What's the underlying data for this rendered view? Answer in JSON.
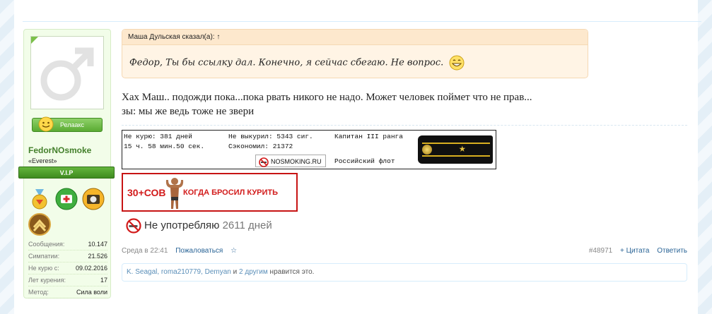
{
  "user": {
    "name": "FedorNOsmoke",
    "title": "«Everest»",
    "rank": "V.I.P",
    "status_button": "Релаакс",
    "stats": [
      {
        "label": "Сообщения:",
        "value": "10.147"
      },
      {
        "label": "Симпатии:",
        "value": "21.526"
      },
      {
        "label": "Не курю с:",
        "value": "09.02.2016"
      },
      {
        "label": "Лет курения:",
        "value": "17"
      },
      {
        "label": "Метод:",
        "value": "Сила воли"
      }
    ]
  },
  "quote": {
    "author": "Маша Дульская сказал(а): ↑",
    "text": "Федор, Ты бы ссылку дал. Конечно, я сейчас сбегаю. Не вопрос."
  },
  "message": {
    "line1": "Хах Маш.. подожди пока...пока рвать никого не надо. Может человек поймет что не прав...",
    "line2": "зы: мы же ведь тоже не звери"
  },
  "signature": {
    "banner": {
      "not_smoking": "Не курю: 381 дней",
      "time": "15 ч. 58 мин.50 сек.",
      "not_smoked": "Не выкурил: 5343 сиг.",
      "saved": "Сэкономил: 21372",
      "rank": "Капитан III ранга",
      "fleet": "Российский флот",
      "logo": "NOSMOKING.RU"
    },
    "red_banner": {
      "left": "30+СОВ",
      "right": "КОГДА БРОСИЛ КУРИТЬ"
    },
    "not_using_text": "Не употребляю",
    "not_using_days": "2611 дней"
  },
  "meta": {
    "date": "Среда в 22:41",
    "report": "Пожаловаться",
    "bookmark": "☆",
    "post_number": "#48971",
    "quote_action": "+ Цитата",
    "reply_action": "Ответить"
  },
  "likes": {
    "users": "K. Seagal, roma210779, Demyan",
    "and": " и ",
    "others": "2 другим",
    "suffix": " нравится это."
  },
  "colors": {
    "accent_green": "#44802c",
    "link_blue": "#2a6496",
    "quote_bg": "#fff4e5",
    "banner_red": "#c71414"
  }
}
